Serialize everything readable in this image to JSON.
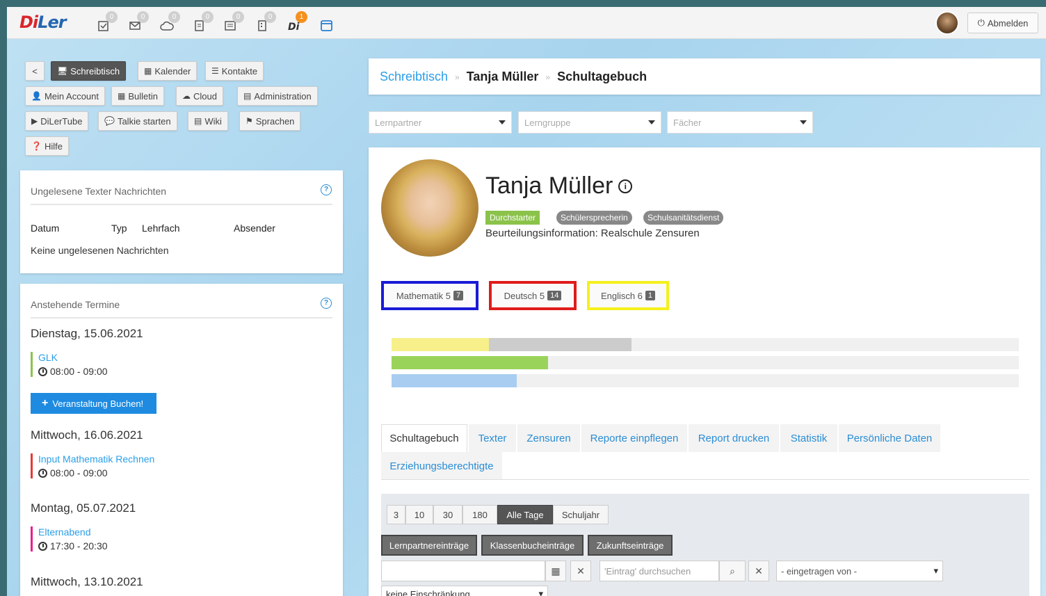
{
  "topbar": {
    "logo_d": "Di",
    "logo_rest": "Ler",
    "icons": [
      {
        "name": "checklist-icon",
        "count": "0"
      },
      {
        "name": "mail-icon",
        "count": "0"
      },
      {
        "name": "cloud-icon",
        "count": "0"
      },
      {
        "name": "document-icon",
        "count": "0"
      },
      {
        "name": "news-icon",
        "count": "0"
      },
      {
        "name": "building-icon",
        "count": "0"
      },
      {
        "name": "diler-talk-icon",
        "count": "1"
      },
      {
        "name": "calendar-icon",
        "count": ""
      }
    ],
    "logout_label": "Abmelden"
  },
  "nav": {
    "back": "<",
    "schreibtisch": "Schreibtisch",
    "kalender": "Kalender",
    "kontakte": "Kontakte",
    "mein_account": "Mein Account",
    "bulletin": "Bulletin",
    "cloud": "Cloud",
    "administration": "Administration",
    "dilertube": "DiLerTube",
    "talkie": "Talkie starten",
    "wiki": "Wiki",
    "sprachen": "Sprachen",
    "hilfe": "Hilfe"
  },
  "messages": {
    "title": "Ungelesene Texter Nachrichten",
    "headers": [
      "Datum",
      "Typ",
      "Lehrfach",
      "Absender"
    ],
    "empty": "Keine ungelesenen Nachrichten"
  },
  "appointments": {
    "title": "Anstehende Termine",
    "book_label": "Veranstaltung Buchen!",
    "days": [
      {
        "date": "Dienstag, 15.06.2021",
        "event": "GLK",
        "time": "08:00 - 09:00",
        "color": "#8bc34a"
      },
      {
        "date": "Mittwoch, 16.06.2021",
        "event": "Input Mathematik Rechnen",
        "time": "08:00 - 09:00",
        "color": "#e53935"
      },
      {
        "date": "Montag, 05.07.2021",
        "event": "Elternabend",
        "time": "17:30 - 20:30",
        "color": "#e91e8c"
      },
      {
        "date": "Mittwoch, 13.10.2021"
      }
    ]
  },
  "breadcrumb": {
    "home": "Schreibtisch",
    "student": "Tanja Müller",
    "page": "Schultagebuch"
  },
  "filters": {
    "lernpartner": "Lernpartner",
    "lerngruppe": "Lerngruppe",
    "faecher": "Fächer"
  },
  "student": {
    "name": "Tanja Müller",
    "tags": [
      "Durchstarter",
      "Schülersprecherin",
      "Schulsanitätsdienst"
    ],
    "beurteilung": "Beurteilungsinformation: Realschule Zensuren",
    "subjects": [
      {
        "label": "Mathematik 5",
        "count": "7",
        "color": "#1a1ad6"
      },
      {
        "label": "Deutsch 5",
        "count": "14",
        "color": "#e01b1b"
      },
      {
        "label": "Englisch 6",
        "count": "1",
        "color": "#f5f01c"
      }
    ],
    "progress": [
      {
        "segments": [
          {
            "color": "#f7ef8a",
            "fraction": 0.155
          },
          {
            "color": "#cccccc",
            "fraction": 0.228
          }
        ]
      },
      {
        "segments": [
          {
            "color": "#9ad35a",
            "fraction": 0.249
          }
        ]
      },
      {
        "segments": [
          {
            "color": "#a8cdf0",
            "fraction": 0.2
          }
        ]
      }
    ]
  },
  "tabs": [
    "Schultagebuch",
    "Texter",
    "Zensuren",
    "Reporte einpflegen",
    "Report drucken",
    "Statistik",
    "Persönliche Daten",
    "Erziehungsberechtigte"
  ],
  "diary": {
    "ranges": [
      "3",
      "10",
      "30",
      "180",
      "Alle Tage",
      "Schuljahr"
    ],
    "entry_types": [
      "Lernpartnereinträge",
      "Klassenbucheinträge",
      "Zukunftseinträge"
    ],
    "search_placeholder": "'Eintrag' durchsuchen",
    "author_select": "- eingetragen von -",
    "restriction": "keine Einschränkung"
  }
}
